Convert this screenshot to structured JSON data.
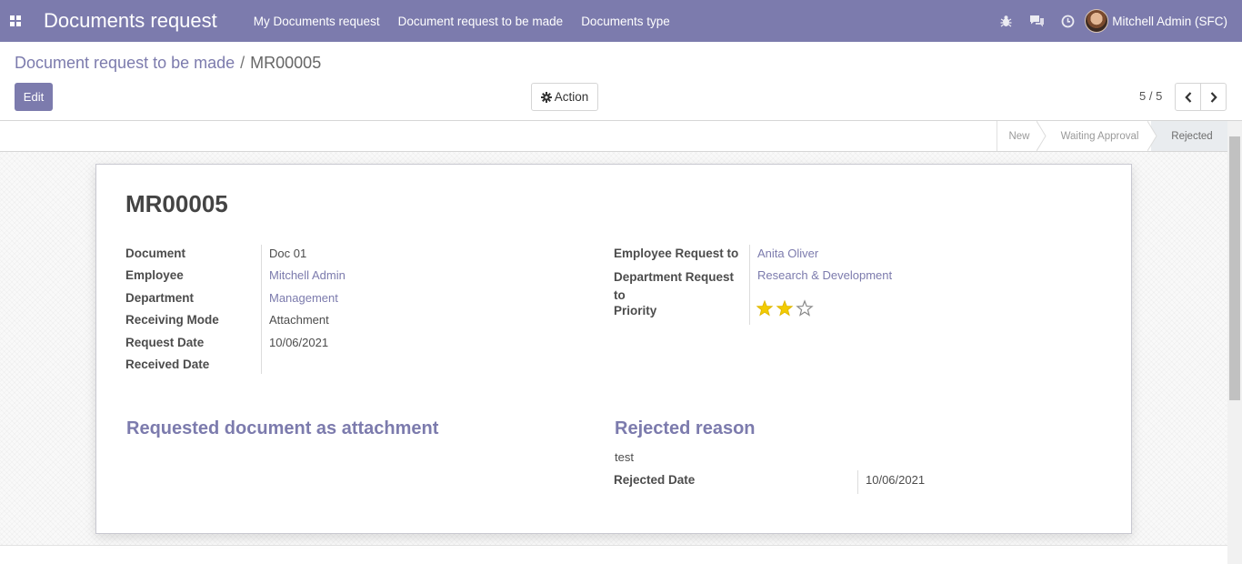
{
  "navbar": {
    "app_title": "Documents request",
    "menu": [
      "My Documents request",
      "Document request to be made",
      "Documents type"
    ],
    "user_name": "Mitchell Admin (SFC)",
    "accent": "#7c7bad"
  },
  "breadcrumb": {
    "parent": "Document request to be made",
    "separator": "/",
    "current": "MR00005"
  },
  "toolbar": {
    "edit_label": "Edit",
    "action_label": "Action",
    "pager_value": "5 / 5"
  },
  "statusbar": {
    "stages": [
      "New",
      "Waiting Approval",
      "Rejected"
    ],
    "active_stage": "Rejected"
  },
  "record": {
    "name": "MR00005",
    "left_fields": [
      {
        "label": "Document",
        "value": "Doc 01"
      },
      {
        "label": "Employee",
        "value": "Mitchell Admin"
      },
      {
        "label": "Department",
        "value": "Management"
      },
      {
        "label": "Receiving Mode",
        "value": "Attachment"
      },
      {
        "label": "Request Date",
        "value": "10/06/2021"
      },
      {
        "label": "Received Date",
        "value": ""
      }
    ],
    "right_fields": [
      {
        "label": "Employee Request to",
        "value": "Anita Oliver"
      },
      {
        "label": "Department Request to",
        "value": "Research & Development"
      },
      {
        "label": "Priority",
        "value": ""
      }
    ],
    "priority_stars": 2,
    "priority_max": 3,
    "attachment_section_title": "Requested document as attachment",
    "rejected_section_title": "Rejected reason",
    "rejected_reason": "test",
    "rejected_date_label": "Rejected Date",
    "rejected_date_value": "10/06/2021"
  }
}
